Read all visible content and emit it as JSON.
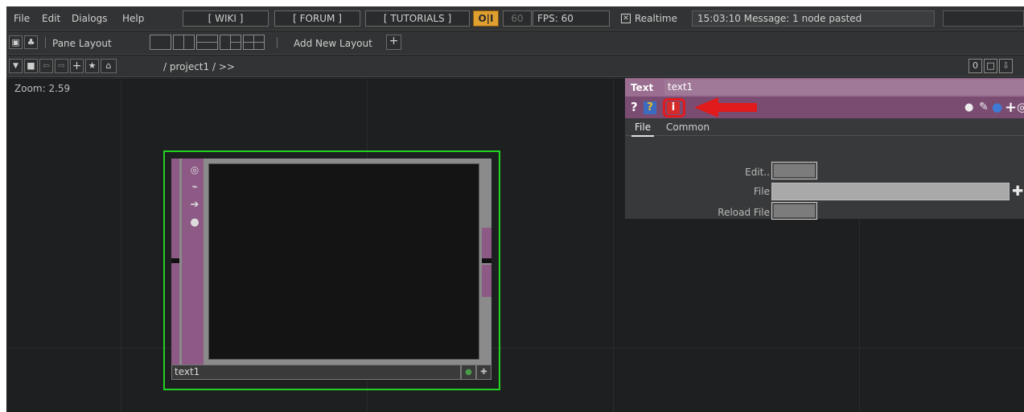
{
  "menu": {
    "items": [
      "File",
      "Edit",
      "Dialogs",
      "Help"
    ],
    "wiki": "[ WIKI ]",
    "forum": "[ FORUM ]",
    "tutorials": "[ TUTORIALS ]",
    "perform_toggle": "O|I",
    "fps_value": "60",
    "fps_label": "FPS:  60",
    "realtime_label": "Realtime",
    "message": "15:03:10 Message: 1 node pasted"
  },
  "panebar": {
    "pane_layout_label": "Pane Layout",
    "add_layout_label": "Add New Layout",
    "add_symbol": "+"
  },
  "pathbar": {
    "path": "/ project1 / >>",
    "right_num": "0"
  },
  "canvas": {
    "zoom": "Zoom: 2.59"
  },
  "node": {
    "name": "text1"
  },
  "params": {
    "op_type": "Text",
    "op_name": "text1",
    "help_q": "?",
    "python_help_q": "?",
    "info": "i",
    "tabs": [
      "File",
      "Common"
    ],
    "rows": [
      {
        "label": "Edit.."
      },
      {
        "label": "File"
      },
      {
        "label": "Reload File"
      }
    ]
  },
  "colors": {
    "node_selected": "#22d322",
    "op_family_purple": "#8d5a86",
    "highlight_red": "#e11b1b",
    "perform_orange": "#e0a030"
  }
}
